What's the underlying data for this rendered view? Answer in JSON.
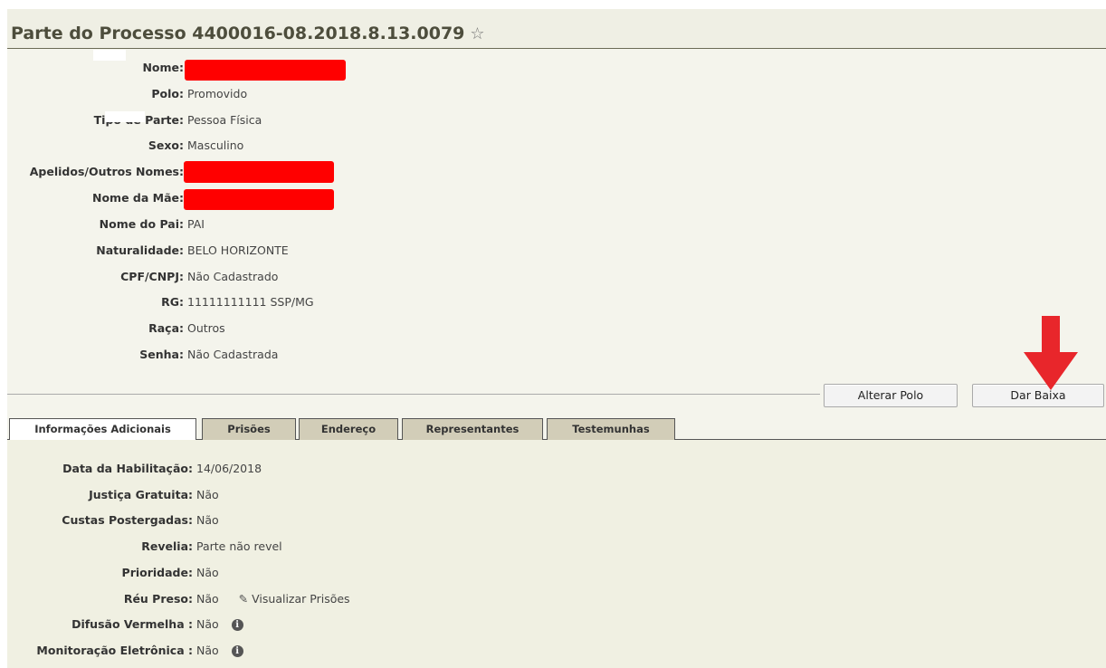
{
  "header": {
    "title": "Parte do Processo 4400016-08.2018.8.13.0079",
    "favorite_icon": "star-outline-icon"
  },
  "party": {
    "fields": [
      {
        "label": "Nome:",
        "value": ""
      },
      {
        "label": "Polo:",
        "value": "Promovido"
      },
      {
        "label": "Tipo de Parte:",
        "value": "Pessoa Física"
      },
      {
        "label": "Sexo:",
        "value": "Masculino"
      },
      {
        "label": "Apelidos/Outros Nomes:",
        "value": ""
      },
      {
        "label": "Nome da Mãe:",
        "value": ""
      },
      {
        "label": "Nome do Pai:",
        "value": "PAI"
      },
      {
        "label": "Naturalidade:",
        "value": "BELO HORIZONTE"
      },
      {
        "label": "CPF/CNPJ:",
        "value": "Não Cadastrado"
      },
      {
        "label": "RG:",
        "value": "11111111111 SSP/MG"
      },
      {
        "label": "Raça:",
        "value": "Outros"
      },
      {
        "label": "Senha:",
        "value": "Não Cadastrada"
      }
    ]
  },
  "actions": {
    "alterar_polo": "Alterar Polo",
    "dar_baixa": "Dar Baixa"
  },
  "tabs": [
    {
      "label": "Informações Adicionais",
      "active": true
    },
    {
      "label": "Prisões",
      "active": false
    },
    {
      "label": "Endereço",
      "active": false
    },
    {
      "label": "Representantes",
      "active": false
    },
    {
      "label": "Testemunhas",
      "active": false
    }
  ],
  "additional": {
    "fields": [
      {
        "label": "Data da Habilitação:",
        "value": "14/06/2018"
      },
      {
        "label": "Justiça Gratuita:",
        "value": "Não"
      },
      {
        "label": "Custas Postergadas:",
        "value": "Não"
      },
      {
        "label": "Revelia:",
        "value": "Parte não revel"
      },
      {
        "label": "Prioridade:",
        "value": "Não"
      },
      {
        "label": "Réu Preso:",
        "value": "Não"
      },
      {
        "label": "Difusão Vermelha :",
        "value": "Não"
      },
      {
        "label": "Monitoração Eletrônica :",
        "value": "Não"
      }
    ],
    "visualizar_prisoes": "Visualizar Prisões"
  },
  "colors": {
    "redaction": "#ff0000",
    "annotation_arrow": "#e8262b",
    "tab_inactive": "#d2cdb8",
    "panel_bg": "#f0f0e2"
  }
}
